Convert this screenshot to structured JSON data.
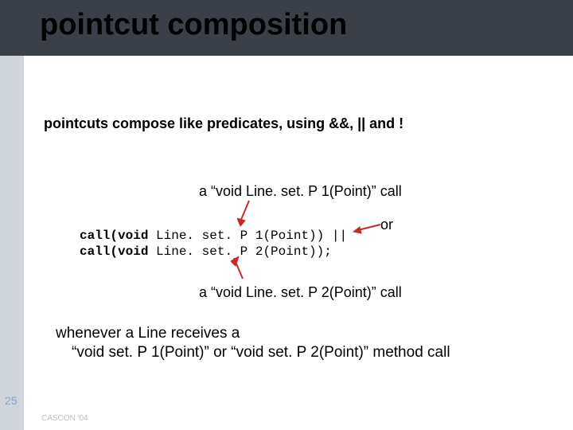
{
  "title": "pointcut composition",
  "subtitle": "pointcuts compose like predicates, using &&, || and !",
  "annotation_top": "a “void Line. set. P 1(Point)” call",
  "annotation_or": "or",
  "annotation_bottom": "a “void Line. set. P 2(Point)” call",
  "code_kw": "call(void",
  "code_l1_rest": " Line. set. P 1(Point)) ||",
  "code_l2_rest": " Line. set. P 2(Point));",
  "explain_line1": "whenever a Line receives a",
  "explain_line2": "“void set. P 1(Point)” or “void set. P 2(Point)” method call",
  "page_number": "25",
  "footer": "CASCON '04"
}
